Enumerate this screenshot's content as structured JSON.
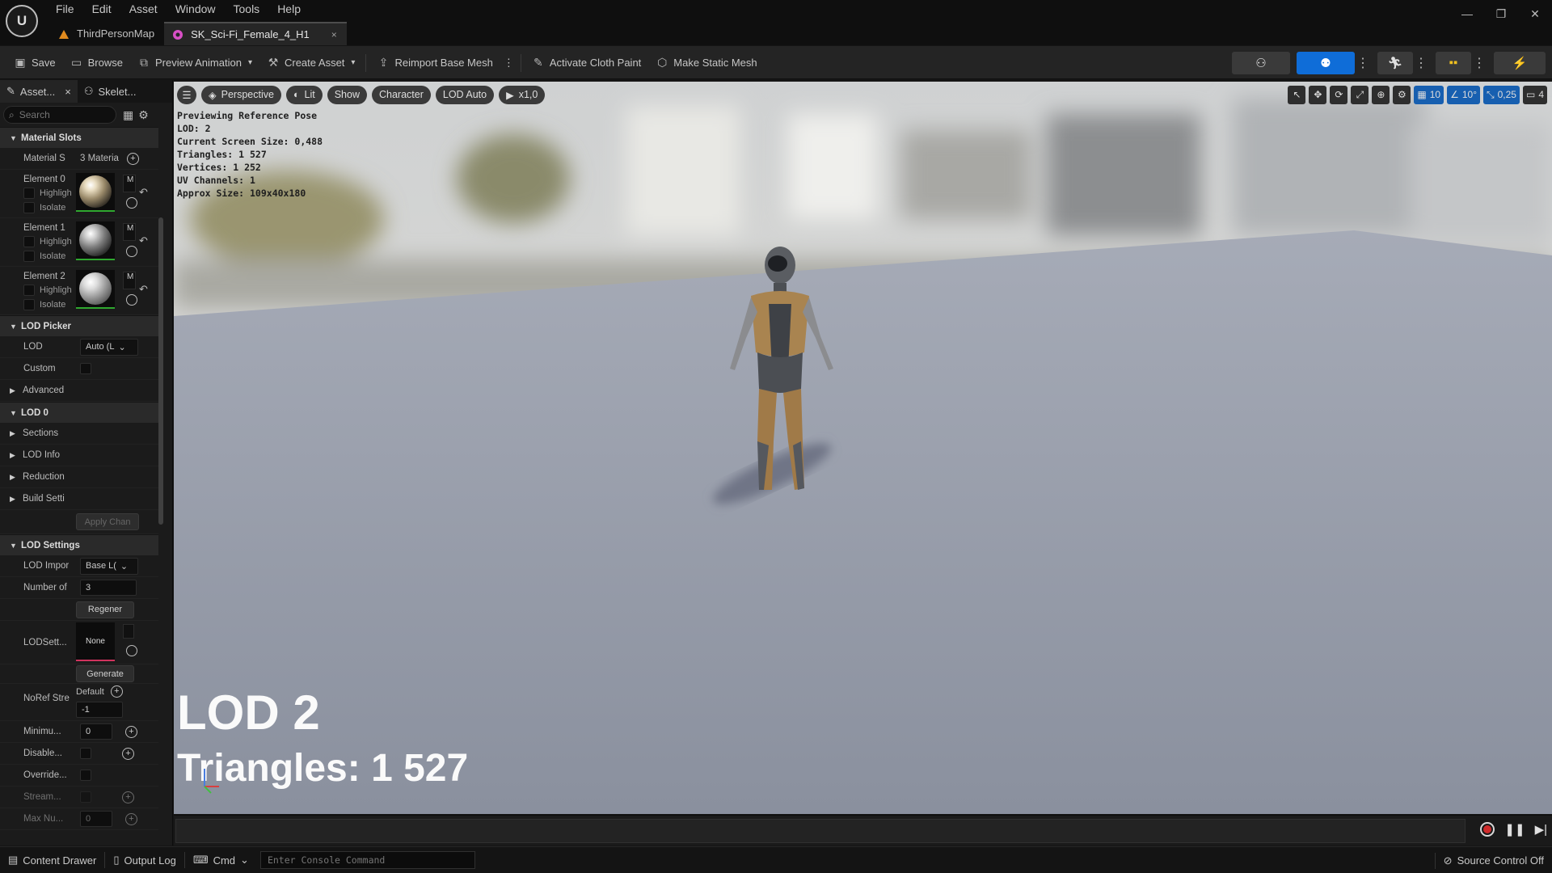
{
  "menu": [
    "File",
    "Edit",
    "Asset",
    "Window",
    "Tools",
    "Help"
  ],
  "tabs": [
    {
      "label": "ThirdPersonMap"
    },
    {
      "label": "SK_Sci-Fi_Female_4_H1",
      "close": "×"
    }
  ],
  "window_controls": {
    "minimize": "—",
    "restore": "❐",
    "close": "✕"
  },
  "toolbar": {
    "save": "Save",
    "browse": "Browse",
    "preview_animation": "Preview Animation",
    "create_asset": "Create Asset",
    "reimport": "Reimport Base Mesh",
    "cloth_paint": "Activate Cloth Paint",
    "static_mesh": "Make Static Mesh"
  },
  "left_tabs": {
    "asset": "Asset...",
    "skeleton": "Skelet...",
    "close": "×"
  },
  "search": {
    "placeholder": "Search"
  },
  "material_slots": {
    "title": "Material Slots",
    "slots_label": "Material S",
    "slots_value": "3 Materia",
    "elements": [
      {
        "label": "Element 0",
        "highlight": "Highligh",
        "isolate": "Isolate",
        "m": "M"
      },
      {
        "label": "Element 1",
        "highlight": "Highligh",
        "isolate": "Isolate",
        "m": "M"
      },
      {
        "label": "Element 2",
        "highlight": "Highligh",
        "isolate": "Isolate",
        "m": "M"
      }
    ]
  },
  "lod_picker": {
    "title": "LOD Picker",
    "lod_label": "LOD",
    "lod_value": "Auto (L",
    "custom_label": "Custom",
    "advanced": "Advanced"
  },
  "lod0": {
    "title": "LOD 0",
    "sections": "Sections",
    "lod_info": "LOD Info",
    "reduction": "Reduction",
    "build": "Build Setti",
    "apply": "Apply Chan"
  },
  "lod_settings": {
    "title": "LOD Settings",
    "import_label": "LOD Impor",
    "import_value": "Base L(",
    "number_label": "Number of",
    "number_value": "3",
    "regen": "Regener",
    "lodsett_label": "LODSett...",
    "none": "None",
    "generate": "Generate",
    "noref_label": "NoRef Stre",
    "default": "Default",
    "noref_value": "-1",
    "min_label": "Minimu...",
    "min_value": "0",
    "disable_label": "Disable...",
    "override_label": "Override...",
    "stream_label": "Stream...",
    "maxnum_label": "Max Nu...",
    "maxnum_value": "0"
  },
  "viewport": {
    "perspective": "Perspective",
    "lit": "Lit",
    "show": "Show",
    "character": "Character",
    "lod_auto": "LOD Auto",
    "speed": "x1,0",
    "grid": "10",
    "angle": "10°",
    "scale": "0,25",
    "camera": "4",
    "stats": [
      "Previewing Reference Pose",
      "LOD: 2",
      "Current Screen Size: 0,488",
      "Triangles: 1 527",
      "Vertices: 1 252",
      "UV Channels: 1",
      "Approx Size: 109x40x180"
    ],
    "big_lod": "LOD 2",
    "big_triangles": "Triangles: 1 527"
  },
  "statusbar": {
    "content_drawer": "Content Drawer",
    "output_log": "Output Log",
    "cmd": "Cmd",
    "console_placeholder": "Enter Console Command",
    "source_control": "Source Control Off"
  }
}
